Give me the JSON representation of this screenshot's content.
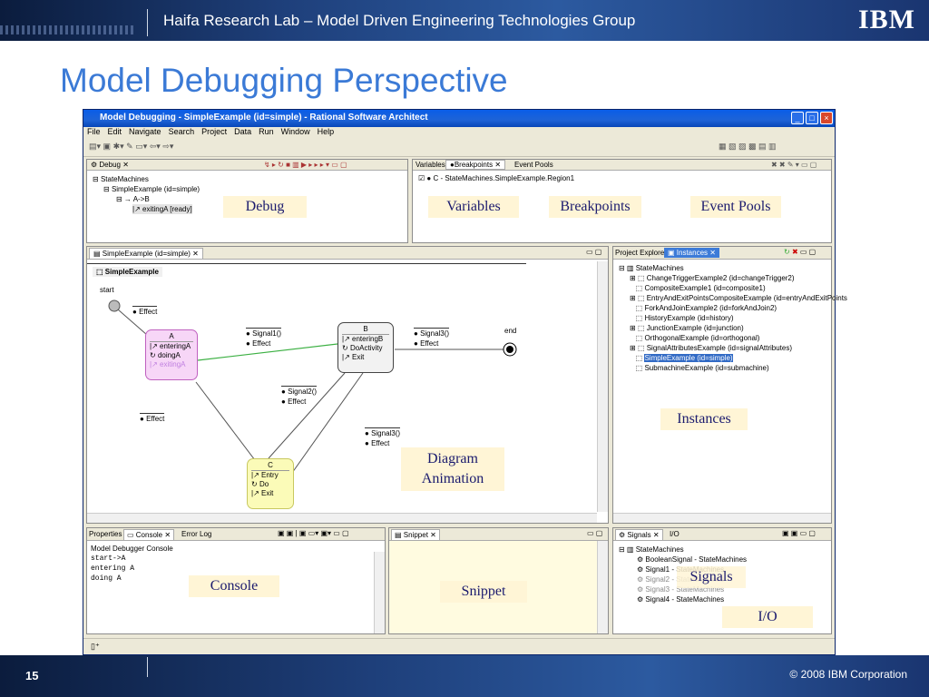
{
  "header": {
    "title": "Haifa Research Lab – Model Driven Engineering Technologies Group",
    "logo": "IBM"
  },
  "page_title": "Model Debugging Perspective",
  "window": {
    "title": "Model Debugging - SimpleExample (id=simple) - Rational Software Architect",
    "menu": [
      "File",
      "Edit",
      "Navigate",
      "Search",
      "Project",
      "Data",
      "Run",
      "Window",
      "Help"
    ]
  },
  "debug_view": {
    "tab": "Debug",
    "tree": [
      "StateMachines",
      "SimpleExample (id=simple)",
      "A->B",
      "exitingA [ready]"
    ]
  },
  "vars_view": {
    "tabs": [
      "Variables",
      "Breakpoints",
      "Event Pools"
    ],
    "breakpoint": "C - StateMachines.SimpleExample.Region1"
  },
  "diagram_view": {
    "tab": "SimpleExample (id=simple)",
    "header": "SimpleExample",
    "start": "start",
    "end": "end",
    "effect": "Effect",
    "signal1": "Signal1()",
    "signal2": "Signal2()",
    "signal3": "Signal3()",
    "stateA": {
      "name": "A",
      "rows": [
        "enteringA",
        "doingA",
        "exitingA"
      ]
    },
    "stateB": {
      "name": "B",
      "rows": [
        "enteringB",
        "DoActivity",
        "Exit"
      ]
    },
    "stateC": {
      "name": "C",
      "rows": [
        "Entry",
        "Do",
        "Exit"
      ]
    }
  },
  "instances_view": {
    "tabs": [
      "Project Explorer",
      "Instances"
    ],
    "root": "StateMachines",
    "items": [
      "ChangeTriggerExample2 (id=changeTrigger2)",
      "CompositeExample1 (id=composite1)",
      "EntryAndExitPointsCompositeExample (id=entryAndExitPoints",
      "ForkAndJoinExample2 (id=forkAndJoin2)",
      "HistoryExample (id=history)",
      "JunctionExample (id=junction)",
      "OrthogonalExample (id=orthogonal)",
      "SignalAttributesExample (id=signalAttributes)",
      "SimpleExample (id=simple)",
      "SubmachineExample (id=submachine)"
    ]
  },
  "console_view": {
    "tabs": [
      "Properties",
      "Console",
      "Error Log"
    ],
    "title": "Model Debugger Console",
    "lines": [
      "start->A",
      "entering A",
      "doing A"
    ]
  },
  "snippet_view": {
    "tab": "Snippet"
  },
  "signals_view": {
    "tabs": [
      "Signals",
      "I/O"
    ],
    "root": "StateMachines",
    "items": [
      "BooleanSignal - StateMachines",
      "Signal1 - StateMachines",
      "Signal2 - StateMachines",
      "Signal3 - StateMachines",
      "Signal4 - StateMachines"
    ]
  },
  "labels": {
    "debug": "Debug",
    "variables": "Variables",
    "breakpoints": "Breakpoints",
    "event_pools": "Event Pools",
    "instances": "Instances",
    "diagram": "Diagram",
    "animation": "Animation",
    "console": "Console",
    "snippet": "Snippet",
    "signals": "Signals",
    "io": "I/O"
  },
  "footer": {
    "page": "15",
    "copyright": "© 2008 IBM Corporation"
  },
  "colors": {
    "accent": "#3b7ad6",
    "banner": "#1e3f7a",
    "stateA": "#f7d6f7",
    "stateC": "#fbfbb8",
    "transition": "#3cb043"
  }
}
